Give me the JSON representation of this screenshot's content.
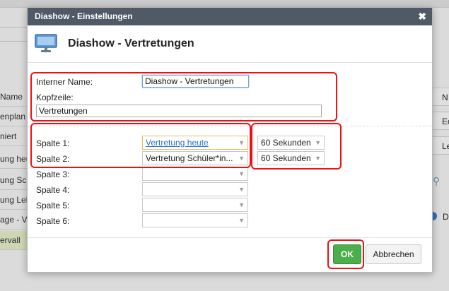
{
  "background": {
    "left_items": [
      "Name",
      "enplan",
      "niert",
      "ung heu",
      "ung Sch",
      "ung Leh",
      "age - V",
      "ervall"
    ],
    "right_items": [
      "N",
      "Ec",
      "Le",
      "D"
    ]
  },
  "dialog": {
    "title": "Diashow - Einstellungen",
    "close_label": "✖",
    "header_title": "Diashow - Vertretungen",
    "internal_name_label": "Interner Name:",
    "internal_name_value": "Diashow - Vertretungen",
    "header_line_label": "Kopfzeile:",
    "header_line_value": "Vertretungen",
    "columns": [
      {
        "label": "Spalte 1:",
        "value": "Vertretung heute",
        "duration": "60 Sekunden"
      },
      {
        "label": "Spalte 2:",
        "value": "Vertretung Schüler*in...",
        "duration": "60 Sekunden"
      },
      {
        "label": "Spalte 3:",
        "value": "",
        "duration": ""
      },
      {
        "label": "Spalte 4:",
        "value": "",
        "duration": ""
      },
      {
        "label": "Spalte 5:",
        "value": "",
        "duration": ""
      },
      {
        "label": "Spalte 6:",
        "value": "",
        "duration": ""
      }
    ],
    "ok_label": "OK",
    "cancel_label": "Abbrechen"
  },
  "colors": {
    "titlebar": "#4f5a66",
    "ok_button": "#4cae4c",
    "highlight": "#ee1111"
  }
}
